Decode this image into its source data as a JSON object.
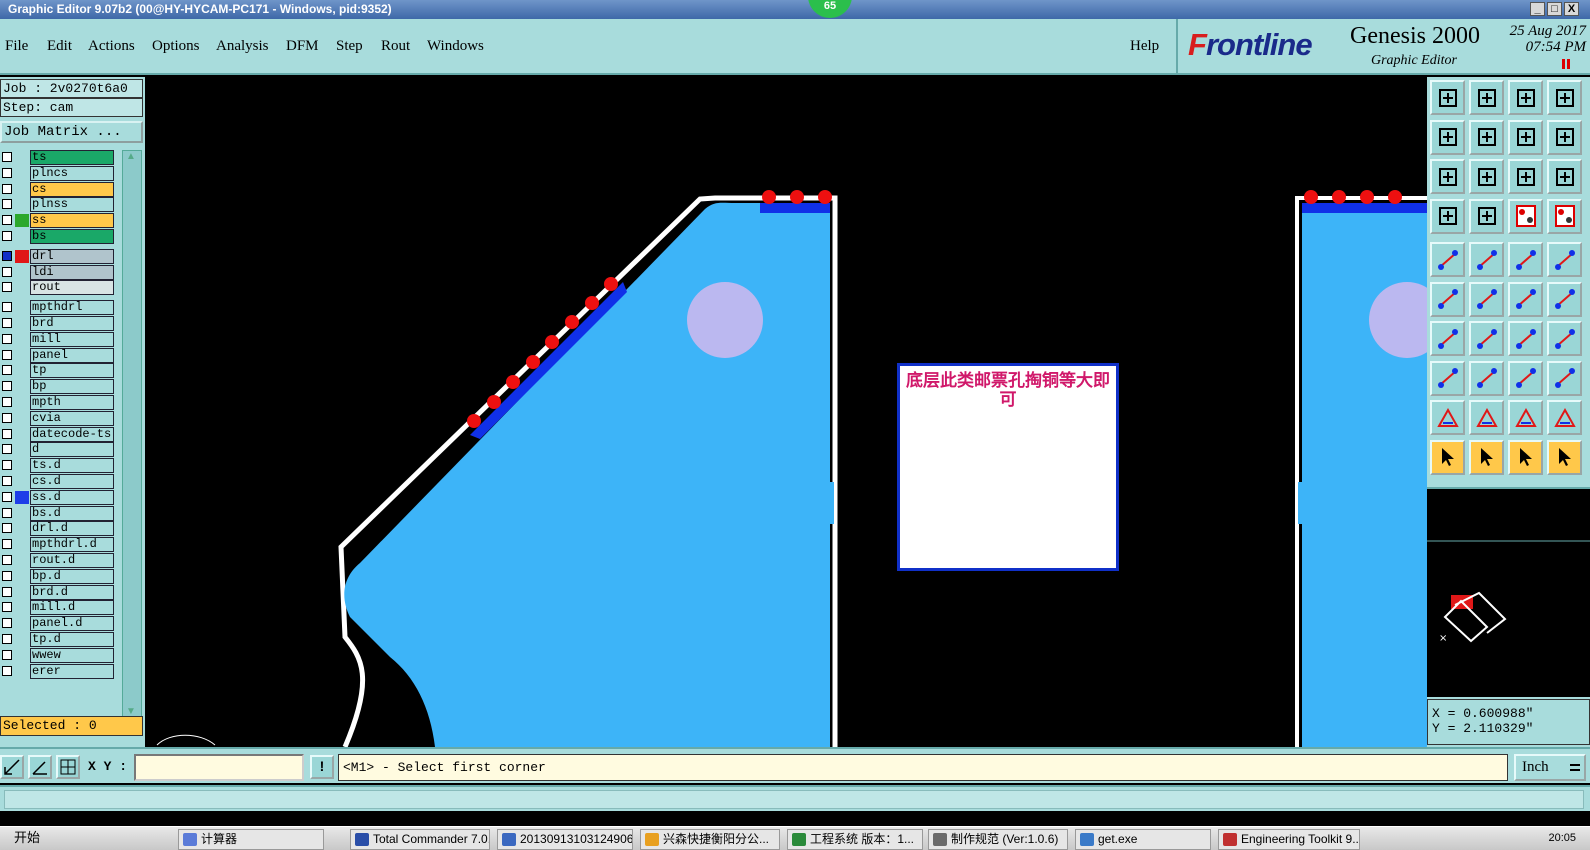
{
  "window": {
    "title": "Graphic Editor 9.07b2 (00@HY-HYCAM-PC171 - Windows, pid:9352)",
    "badge": "65",
    "controls": [
      "_",
      "□",
      "X"
    ]
  },
  "menu": {
    "items": [
      "File",
      "Edit",
      "Actions",
      "Options",
      "Analysis",
      "DFM",
      "Step",
      "Rout",
      "Windows"
    ],
    "help": "Help"
  },
  "brand": {
    "logo_f": "F",
    "logo_rest": "rontline",
    "product": "Genesis 2000",
    "subtitle": "Graphic Editor",
    "date": "25 Aug 2017",
    "time": "07:54 PM"
  },
  "job": {
    "job_label": "Job : 2v0270t6a0",
    "step_label": "Step: cam",
    "matrix_button": "Job Matrix ..."
  },
  "layers": [
    {
      "name": "ts",
      "bg": "#1aa868",
      "swatch": "",
      "checked": false
    },
    {
      "name": "plncs",
      "bg": "#a8dcdc",
      "swatch": "",
      "checked": false
    },
    {
      "name": "cs",
      "bg": "#ffc84a",
      "swatch": "",
      "checked": false
    },
    {
      "name": "plnss",
      "bg": "#a8dcdc",
      "swatch": "",
      "checked": false
    },
    {
      "name": "ss",
      "bg": "#ffc84a",
      "swatch": "#2ca82c",
      "checked": false
    },
    {
      "name": "bs",
      "bg": "#1aa868",
      "swatch": "",
      "checked": false
    },
    {
      "name": "drl",
      "bg": "#b0c4cc",
      "swatch": "#e01818",
      "checked": true
    },
    {
      "name": "ldi",
      "bg": "#b0c4cc",
      "swatch": "",
      "checked": false
    },
    {
      "name": "rout",
      "bg": "#d8e4e4",
      "swatch": "",
      "checked": false
    },
    {
      "name": "mpthdrl",
      "bg": "#a8dcdc",
      "swatch": "",
      "checked": false
    },
    {
      "name": "brd",
      "bg": "#a8dcdc",
      "swatch": "",
      "checked": false
    },
    {
      "name": "mill",
      "bg": "#a8dcdc",
      "swatch": "",
      "checked": false
    },
    {
      "name": "panel",
      "bg": "#a8dcdc",
      "swatch": "",
      "checked": false
    },
    {
      "name": "tp",
      "bg": "#a8dcdc",
      "swatch": "",
      "checked": false
    },
    {
      "name": "bp",
      "bg": "#a8dcdc",
      "swatch": "",
      "checked": false
    },
    {
      "name": "mpth",
      "bg": "#a8dcdc",
      "swatch": "",
      "checked": false
    },
    {
      "name": "cvia",
      "bg": "#a8dcdc",
      "swatch": "",
      "checked": false
    },
    {
      "name": "datecode-ts",
      "bg": "#a8dcdc",
      "swatch": "",
      "checked": false
    },
    {
      "name": "d",
      "bg": "#a8dcdc",
      "swatch": "",
      "checked": false
    },
    {
      "name": "ts.d",
      "bg": "#a8dcdc",
      "swatch": "",
      "checked": false
    },
    {
      "name": "cs.d",
      "bg": "#a8dcdc",
      "swatch": "",
      "checked": false
    },
    {
      "name": "ss.d",
      "bg": "#a8dcdc",
      "swatch": "#1e3ee8",
      "checked": false
    },
    {
      "name": "bs.d",
      "bg": "#a8dcdc",
      "swatch": "",
      "checked": false
    },
    {
      "name": "drl.d",
      "bg": "#a8dcdc",
      "swatch": "",
      "checked": false
    },
    {
      "name": "mpthdrl.d",
      "bg": "#a8dcdc",
      "swatch": "",
      "checked": false
    },
    {
      "name": "rout.d",
      "bg": "#a8dcdc",
      "swatch": "",
      "checked": false
    },
    {
      "name": "bp.d",
      "bg": "#a8dcdc",
      "swatch": "",
      "checked": false
    },
    {
      "name": "brd.d",
      "bg": "#a8dcdc",
      "swatch": "",
      "checked": false
    },
    {
      "name": "mill.d",
      "bg": "#a8dcdc",
      "swatch": "",
      "checked": false
    },
    {
      "name": "panel.d",
      "bg": "#a8dcdc",
      "swatch": "",
      "checked": false
    },
    {
      "name": "tp.d",
      "bg": "#a8dcdc",
      "swatch": "",
      "checked": false
    },
    {
      "name": "wwew",
      "bg": "#a8dcdc",
      "swatch": "",
      "checked": false
    },
    {
      "name": "erer",
      "bg": "#a8dcdc",
      "swatch": "",
      "checked": false
    }
  ],
  "selected_label": "Selected : 0",
  "annotation": {
    "text": "底层此类邮票孔掏铜等大即可"
  },
  "coords": {
    "x": "X = 0.600988\"",
    "y": "Y = 2.110329\""
  },
  "command": {
    "xy_label": "X Y :",
    "xy_value": "",
    "bang": "!",
    "prompt": "<M1> - Select first corner",
    "unit": "Inch"
  },
  "colors": {
    "panel": "#a8dcdc",
    "board_fill": "#3db4f8",
    "pad_red": "#ee1010",
    "edge_blue": "#1030e8",
    "drill_lilac": "#bbb8f0",
    "annotation_text": "#d0186a"
  },
  "taskbar": {
    "start": "开始",
    "tasks": [
      "计算器",
      "Total Commander 7.0...",
      "20130913103124906...",
      "兴森快捷衡阳分公...",
      "工程系统  版本：1...",
      "制作规范 (Ver:1.0.6)",
      "get.exe",
      "Engineering Toolkit 9...."
    ],
    "clock": "20:05"
  }
}
